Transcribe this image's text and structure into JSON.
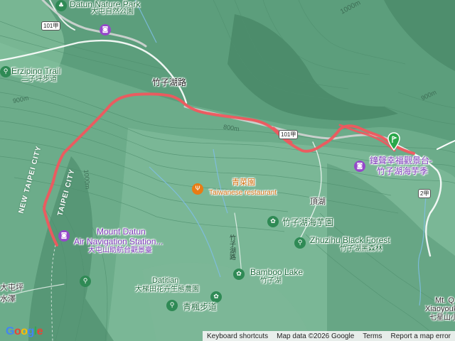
{
  "map": {
    "labels": {
      "datun_park_en": "Datun Nature Park",
      "datun_park_zh": "大屯自然公園",
      "erziping_en": "Erziping Trail",
      "erziping_zh": "二子坪步道",
      "zhuzihu_rd": "竹子湖路",
      "new_taipei": "NEW TAIPEI CITY",
      "taipei": "TAIPEI CITY",
      "qingcai_zh": "青菜園",
      "qingcai_en": "Taiwanese restaurant",
      "zhongsheng_zh1": "鐘聲幸福觀景台-",
      "zhongsheng_zh2": "竹子湖海芋季",
      "dinghu": "頂湖",
      "zhuzihu_taro": "竹子湖海芋園",
      "mount_datun_1": "Mount Datun",
      "mount_datun_2": "Air Navigation Station...",
      "mount_datun_zh": "大屯山助航台觀景臺",
      "zhuzihu_forest_en": "Zhuzihu Black Forest",
      "zhuzihu_forest_zh": "竹子湖黑森林",
      "datitian_en": "Datitian",
      "datitian_zh": "大梯田花卉生態農園",
      "bamboo_lake_en": "Bamboo Lake",
      "bamboo_lake_zh": "竹子湖",
      "qingfeng": "青楓步道",
      "datunping": "大屯坪",
      "zhuzihu_vert": "竹子湖路",
      "water_zh": "水澤",
      "mt_q_1": "Mt. Q",
      "mt_q_2": "Xiaoyouk",
      "mt_q_3": "七星山小"
    },
    "contours": {
      "c1000_top": "1000m",
      "c1000_left": "1000m",
      "c900_left": "900m",
      "c900_right": "900m",
      "c800_mid": "800m"
    },
    "shields": {
      "r101": "101甲",
      "r101b": "101甲",
      "r2": "2甲"
    },
    "attribution": {
      "keyboard": "Keyboard shortcuts",
      "mapdata": "Map data ©2026 Google",
      "terms": "Terms",
      "report": "Report a map error"
    },
    "logo": {
      "G": "G",
      "o1": "o",
      "o2": "o",
      "g": "g",
      "l": "l",
      "e": "e"
    },
    "colors": {
      "route": "#f0575e",
      "terrain": "#5c9e7c",
      "pin_start": "#2aa84a",
      "poi_purple": "#9549c9",
      "poi_green": "#2f8a55",
      "poi_orange": "#e97c14"
    },
    "icons": {
      "park": "tree-icon",
      "camera": "camera-icon",
      "restaurant": "fork-knife-icon",
      "flower": "flower-icon",
      "hiking": "hiker-icon",
      "start": "start-pin-icon"
    }
  }
}
